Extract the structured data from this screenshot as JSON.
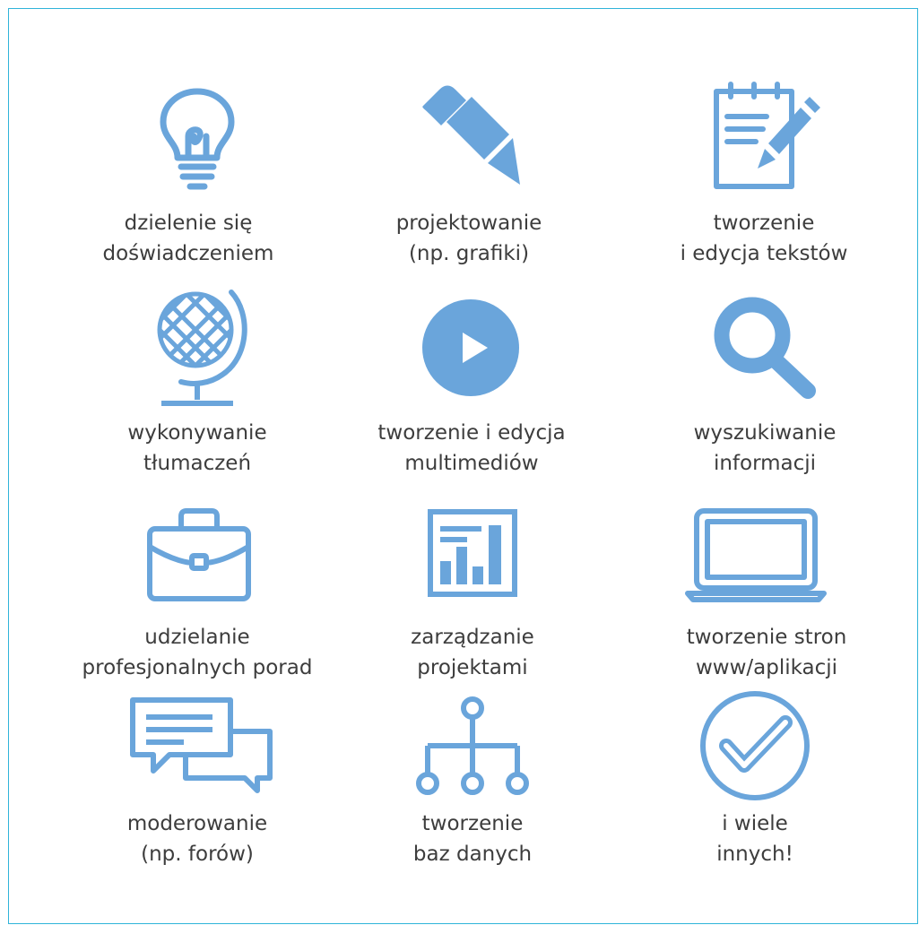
{
  "colors": {
    "icon": "#6aa5db",
    "text": "#3d3d3d",
    "frame": "#2fb4d9"
  },
  "items": [
    {
      "icon": "lightbulb-icon",
      "line1": "dzielenie się",
      "line2": "doświadczeniem"
    },
    {
      "icon": "pencil-icon",
      "line1": "projektowanie",
      "line2": "(np. grafiki)"
    },
    {
      "icon": "notepad-icon",
      "line1": "tworzenie",
      "line2": "i edycja tekstów"
    },
    {
      "icon": "globe-icon",
      "line1": "wykonywanie",
      "line2": "tłumaczeń"
    },
    {
      "icon": "play-icon",
      "line1": "tworzenie i edycja",
      "line2": "multimediów"
    },
    {
      "icon": "search-icon",
      "line1": "wyszukiwanie",
      "line2": "informacji"
    },
    {
      "icon": "briefcase-icon",
      "line1": "udzielanie",
      "line2": "profesjonalnych porad"
    },
    {
      "icon": "chart-icon",
      "line1": "zarządzanie",
      "line2": "projektami"
    },
    {
      "icon": "laptop-icon",
      "line1": "tworzenie stron",
      "line2": "www/aplikacji"
    },
    {
      "icon": "chat-icon",
      "line1": "moderowanie",
      "line2": "(np. forów)"
    },
    {
      "icon": "network-icon",
      "line1": "tworzenie",
      "line2": "baz danych"
    },
    {
      "icon": "checkmark-icon",
      "line1": "i wiele",
      "line2": "innych!"
    }
  ]
}
